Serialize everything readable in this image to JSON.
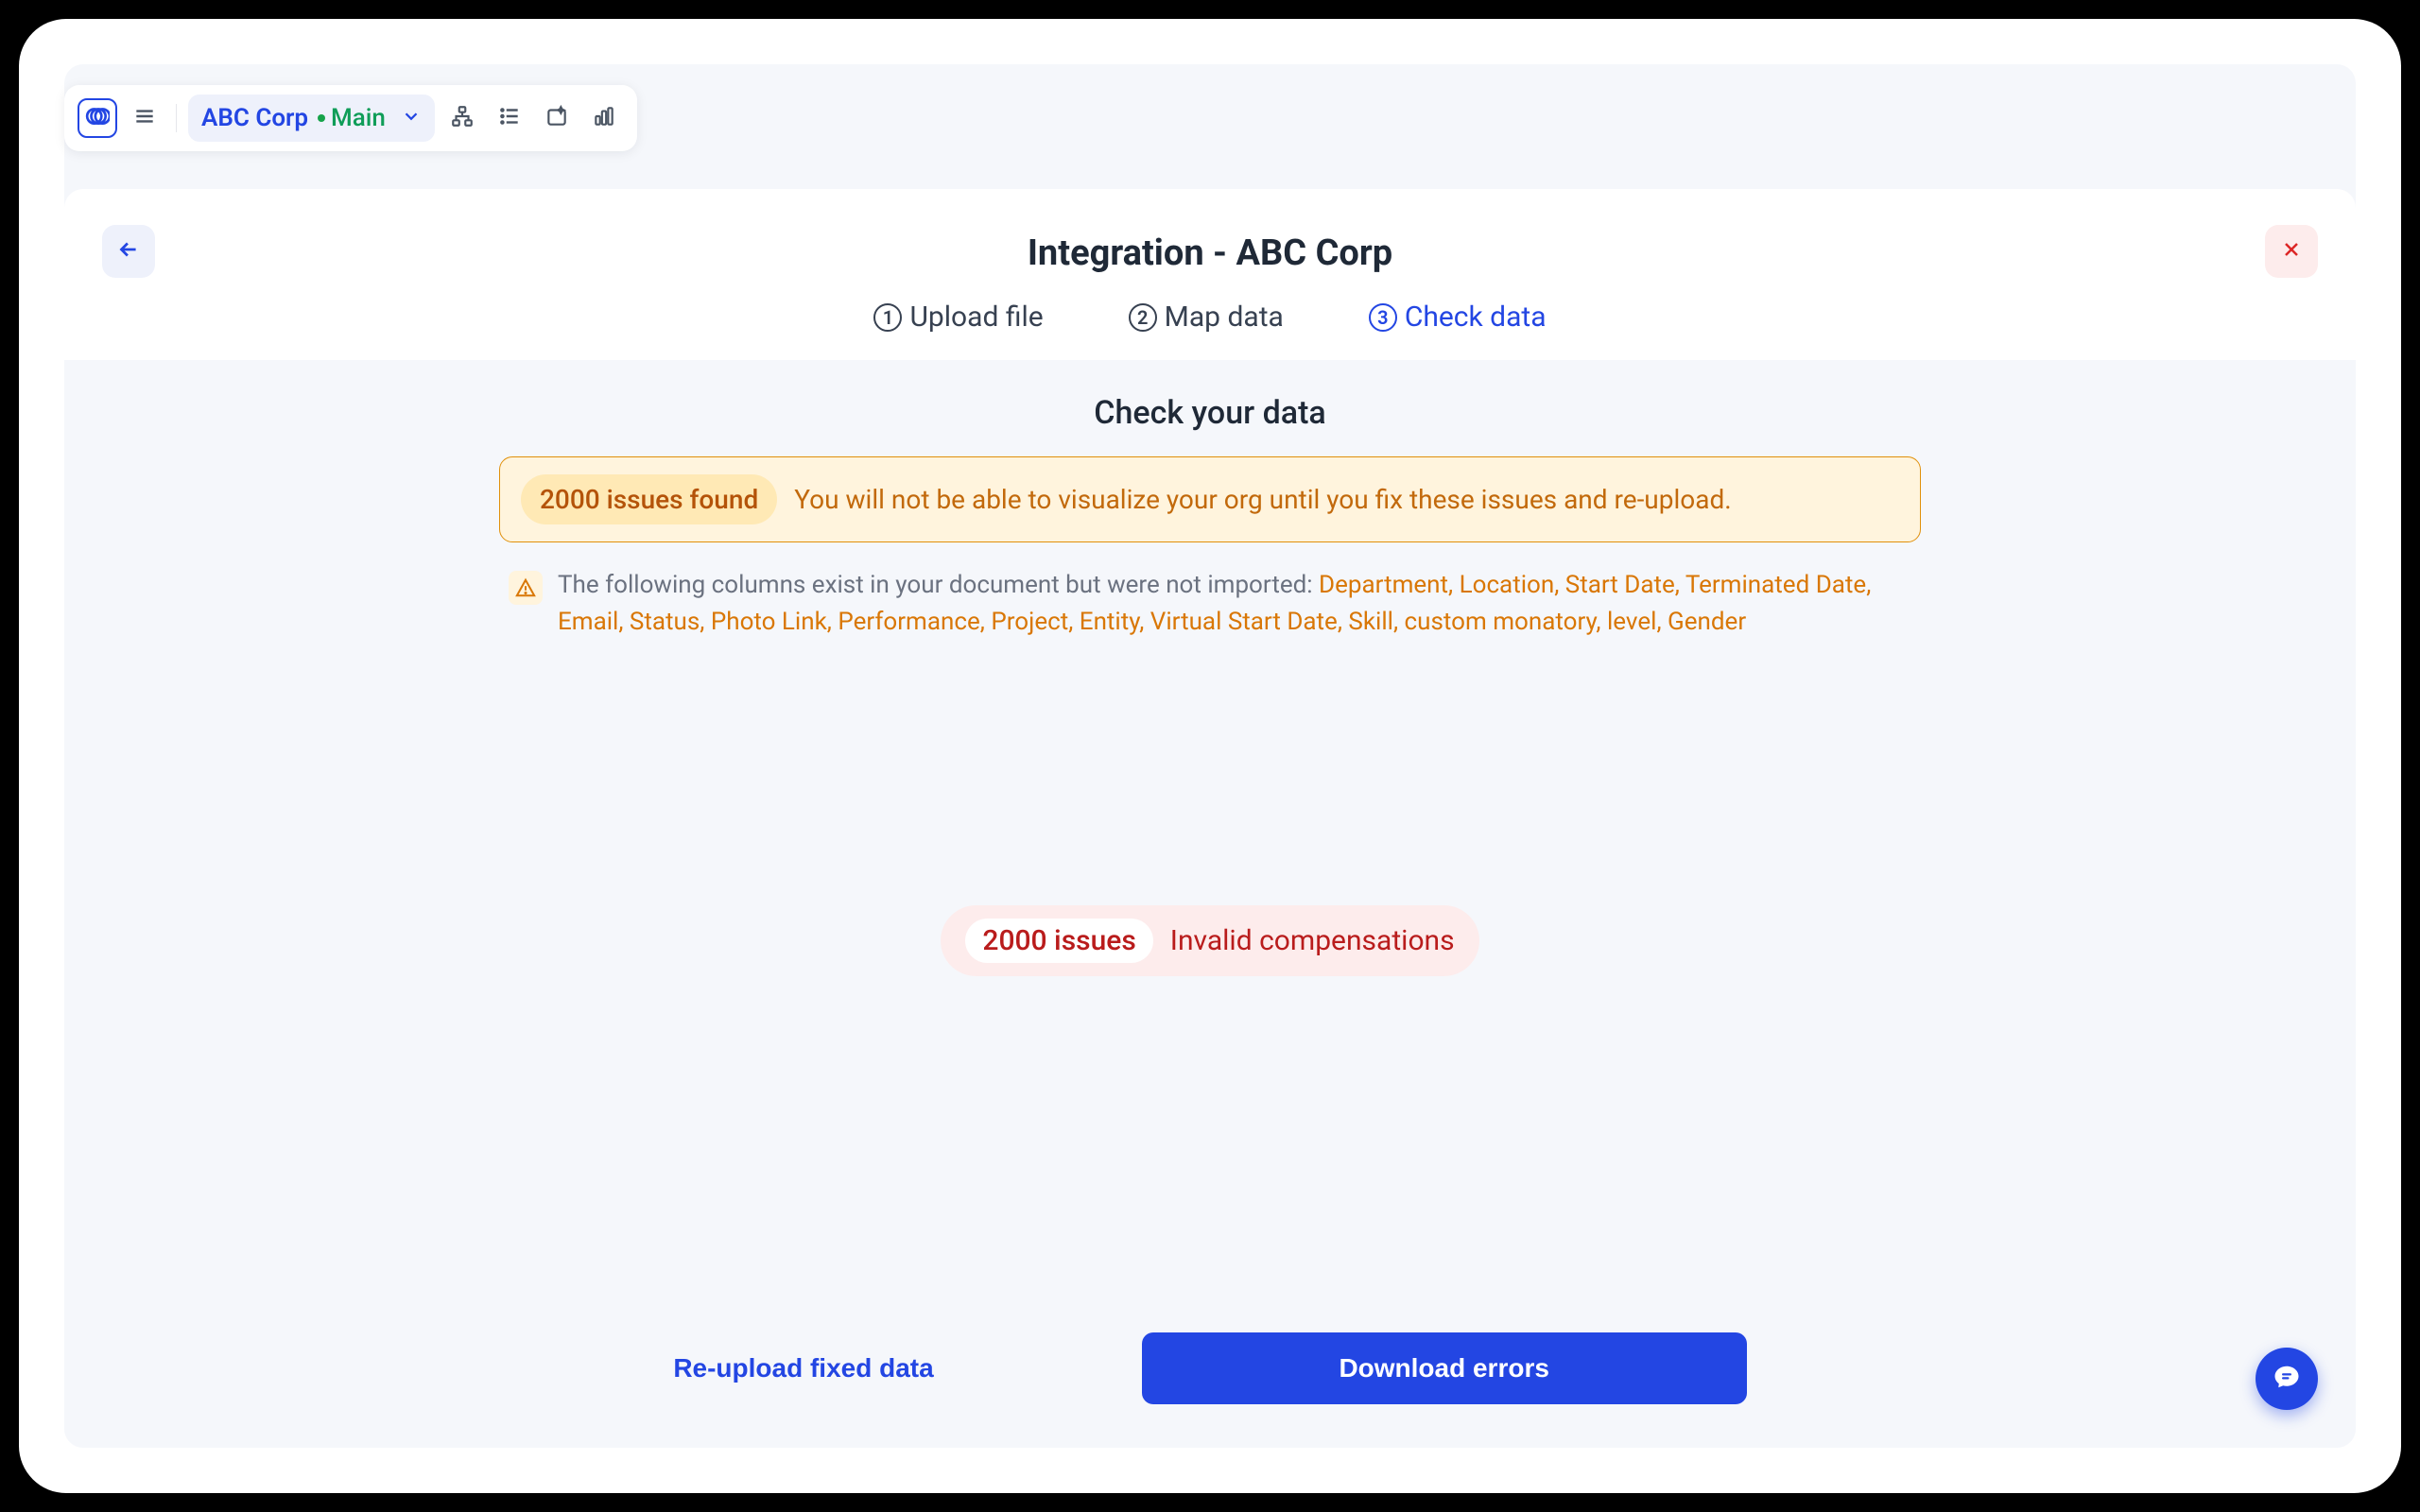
{
  "toolbar": {
    "org_name": "ABC Corp",
    "branch": "Main"
  },
  "panel": {
    "title": "Integration - ABC Corp",
    "steps": [
      {
        "num": "1",
        "label": "Upload file"
      },
      {
        "num": "2",
        "label": "Map data"
      },
      {
        "num": "3",
        "label": "Check data"
      }
    ],
    "active_step_index": 2
  },
  "body": {
    "heading": "Check your data",
    "alert": {
      "pill": "2000 issues found",
      "text": "You will not be able to visualize your org until you fix these issues and re-upload."
    },
    "info": {
      "prefix": "The following columns exist in your document but were not imported: ",
      "columns": "Department, Location, Start Date, Terminated Date, Email, Status, Photo Link, Performance, Project, Entity, Virtual Start Date, Skill, custom monatory, level, Gender"
    },
    "issue_chip": {
      "count": "2000 issues",
      "label": "Invalid compensations"
    }
  },
  "footer": {
    "reupload": "Re-upload fixed data",
    "download": "Download errors"
  }
}
